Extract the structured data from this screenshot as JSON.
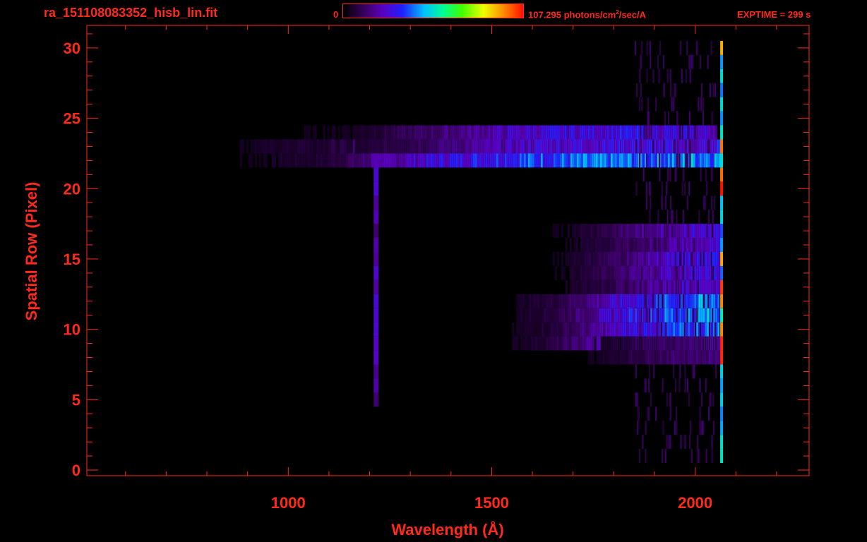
{
  "header": {
    "filename": "ra_151108083352_hisb_lin.fit",
    "colorbar_min": "0",
    "colorbar_max_value": "107.295",
    "colorbar_units_pre": " photons/cm",
    "colorbar_units_sup": "2",
    "colorbar_units_post": "/sec/A",
    "exptime": "EXPTIME = 299 s"
  },
  "colors": {
    "axis": "#ff2a1a",
    "background": "#000000"
  },
  "chart_data": {
    "type": "heatmap",
    "title": "ra_151108083352_hisb_lin.fit",
    "xlabel": "Wavelength (Å)",
    "ylabel": "Spatial Row (Pixel)",
    "xlim": [
      505,
      2280
    ],
    "ylim": [
      -0.4,
      31.6
    ],
    "xticks": [
      1000,
      1500,
      2000
    ],
    "yticks": [
      0,
      5,
      10,
      15,
      20,
      25,
      30
    ],
    "xminor_step": 100,
    "yminor_step": 1,
    "colorbar": {
      "min": 0,
      "max": 107.295,
      "units": "photons/cm²/sec/A"
    },
    "bands": [
      {
        "rows": [
          22,
          23
        ],
        "x_start": 850,
        "x_end": 2060,
        "intensity": [
          0.04,
          0.08,
          0.3,
          0.42,
          0.45,
          0.52
        ]
      },
      {
        "rows": [
          23,
          24
        ],
        "x_start": 940,
        "x_end": 2050,
        "intensity": [
          0.03,
          0.06,
          0.18,
          0.3,
          0.34,
          0.28
        ]
      },
      {
        "rows": [
          12,
          9
        ],
        "x_start": 1550,
        "x_end": 2060,
        "intensity": [
          0.05,
          0.1,
          0.22,
          0.36,
          0.44,
          0.5
        ]
      },
      {
        "rows": [
          17,
          13
        ],
        "x_start": 1650,
        "x_end": 2060,
        "intensity": [
          0.04,
          0.08,
          0.14,
          0.22,
          0.28,
          0.3
        ]
      },
      {
        "rows": [
          9,
          8
        ],
        "x_start": 1700,
        "x_end": 2060,
        "intensity": [
          0.03,
          0.06,
          0.1,
          0.14,
          0.17,
          0.18
        ]
      }
    ],
    "lya_line": {
      "x": 1216,
      "rows": [
        5,
        22
      ],
      "intensity": 0.22
    },
    "edge_line": {
      "x": 2065,
      "rows": [
        1,
        30
      ],
      "hot_rows": [
        21,
        20,
        15,
        13,
        12,
        10,
        9,
        8,
        23,
        30
      ]
    }
  }
}
